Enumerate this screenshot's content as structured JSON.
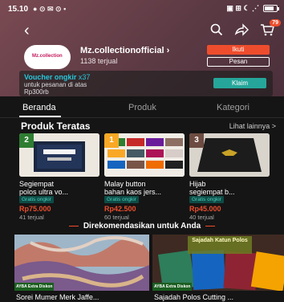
{
  "status": {
    "time": "15.10",
    "left_icons": "● ⊙ ✉ ⊙ •",
    "right_icons": "▣ ⊞ ☾ ⋰"
  },
  "shop": {
    "name": "Mz.collectionofficial",
    "followers": "1138 terjual",
    "logo_text": "Mz.collection",
    "follow_label": "Ikuti",
    "chat_label": "Pesan"
  },
  "cart_badge": "79",
  "voucher": {
    "title": "Voucher ongkir",
    "count": "x37",
    "desc_line1": "untuk pesanan di atas",
    "desc_line2": "Rp300rb",
    "claim_label": "Klaim"
  },
  "tabs": [
    {
      "label": "Beranda"
    },
    {
      "label": "Produk"
    },
    {
      "label": "Kategori"
    }
  ],
  "section": {
    "title": "Produk Teratas",
    "see_more": "Lihat lainnya >"
  },
  "products": [
    {
      "rank": "2",
      "name": "Segiempat\npolos ultra vo...",
      "badge": "Gratis ongkir",
      "price": "Rp75.000",
      "sold": "41 terjual",
      "rank_color": "#2e7d32"
    },
    {
      "rank": "1",
      "name": "Malay button\nbahan kaos jers...",
      "badge": "Gratis ongkir",
      "price": "Rp42.500",
      "sold": "60 terjual",
      "rank_color": "#f9a825"
    },
    {
      "rank": "3",
      "name": "Hijab\nsegiempat b...",
      "badge": "Gratis ongkir",
      "price": "Rp45.000",
      "sold": "40 terjual",
      "rank_color": "#6d4c41"
    }
  ],
  "recommend": {
    "title": "Direkomendasikan untuk Anda",
    "items": [
      {
        "name": "Sorei Mumer Merk Jaffe...",
        "tag": "AYBA Extra Diskon"
      },
      {
        "name": "Sajadah Polos Cutting ...",
        "tag": "AYBA Extra Diskon",
        "banner": "Sajadah Katun Polos"
      }
    ]
  }
}
